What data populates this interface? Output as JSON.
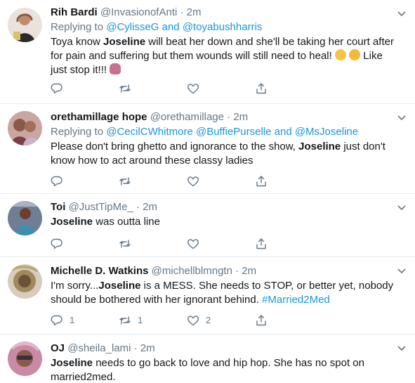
{
  "tweets": [
    {
      "name": "Rih Bardi",
      "handle": "@InvasionofAnti",
      "dot": "·",
      "time": "2m",
      "replying_prefix": "Replying to ",
      "replying_links": "@CylisseG and @toyabushharris",
      "text_before": "Toya know ",
      "bold": "Joseline",
      "text_after": " will beat her down and she'll be taking her court after for pain and suffering but them wounds will still need to heal! ",
      "text_tail": " Like just stop it!!! ",
      "replies": "",
      "retweets": "",
      "likes": ""
    },
    {
      "name": "orethamillage hope",
      "handle": "@orethamillage",
      "dot": "·",
      "time": "2m",
      "replying_prefix": "Replying to ",
      "replying_links": "@CecilCWhitmore @BuffiePurselle and @MsJoseline",
      "text_before": "Please don't bring ghetto and ignorance to the show, ",
      "bold": "Joseline",
      "text_after": " just don't know how to act around these classy ladies",
      "replies": "",
      "retweets": "",
      "likes": ""
    },
    {
      "name": "Toi",
      "handle": "@JustTipMe_",
      "dot": "·",
      "time": "2m",
      "bold": "Joseline",
      "text_after": " was outta line",
      "replies": "",
      "retweets": "",
      "likes": ""
    },
    {
      "name": "Michelle D. Watkins",
      "handle": "@michellblmngtn",
      "dot": "·",
      "time": "2m",
      "text_before": "I'm sorry...",
      "bold": "Joseline",
      "text_after": " is a MESS.  She needs to STOP, or better yet, nobody should be bothered with her ignorant behind.  ",
      "hashtag": "#Married2Med",
      "replies": "1",
      "retweets": "1",
      "likes": "2"
    },
    {
      "name": "OJ",
      "handle": "@sheila_lami",
      "dot": "·",
      "time": "2m",
      "bold": "Joseline",
      "text_after": " needs to go back to love and hip hop. She has no spot on married2med."
    }
  ],
  "icons": {
    "reply": "reply-icon",
    "retweet": "retweet-icon",
    "like": "heart-icon",
    "share": "share-icon",
    "caret": "chevron-down-icon"
  },
  "colors": {
    "link": "#1b95e0",
    "secondary": "#657786",
    "text": "#14171a",
    "divider": "#e6ecf0"
  }
}
